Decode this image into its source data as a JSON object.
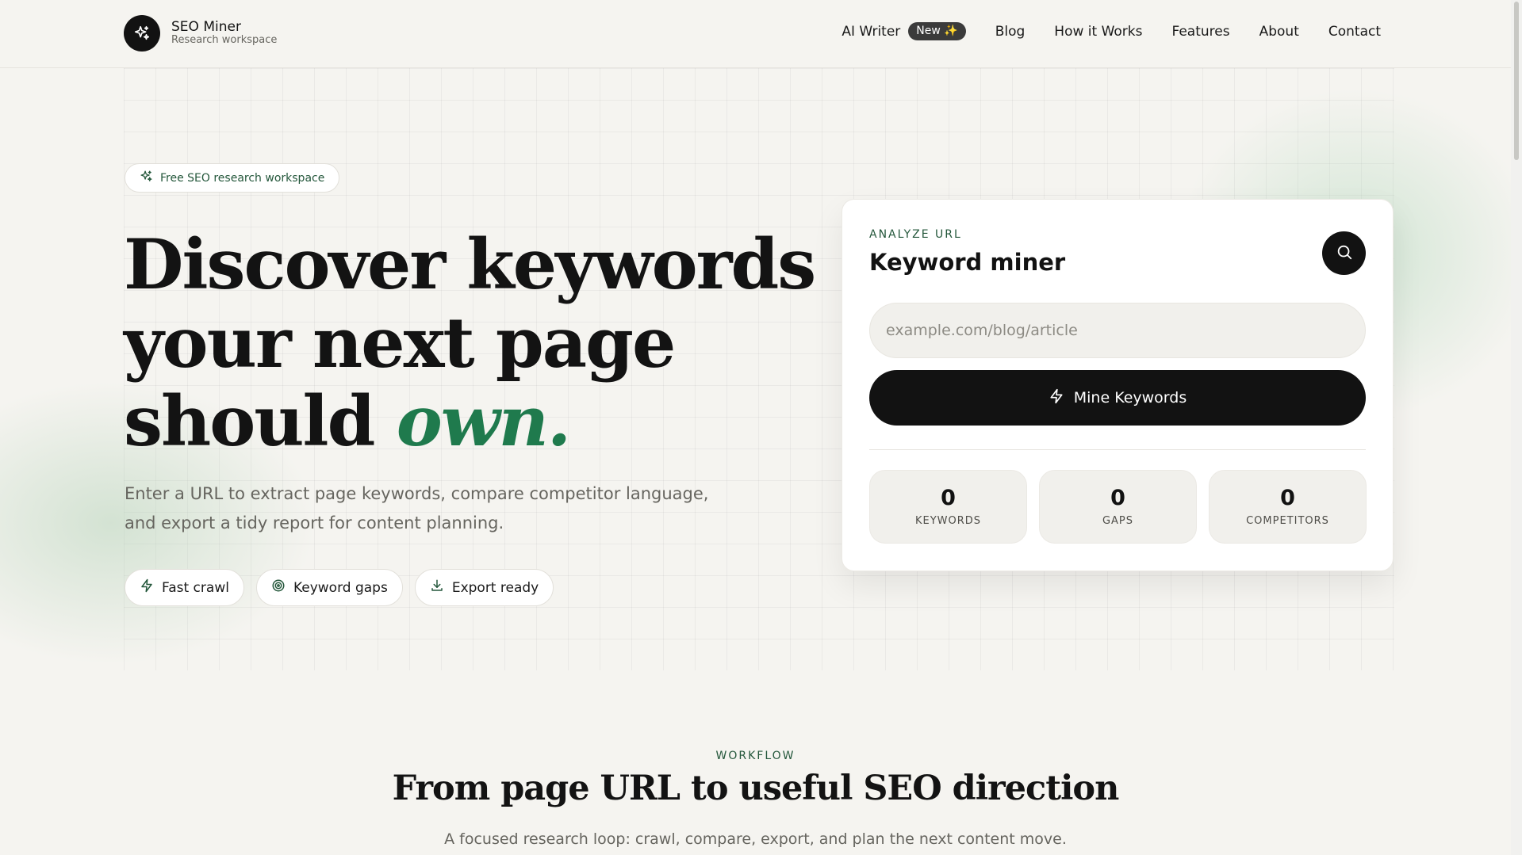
{
  "brand": {
    "name": "SEO Miner",
    "tagline": "Research workspace",
    "icon": "sparkle-icon"
  },
  "nav": {
    "ai_writer": "AI Writer",
    "new_badge": "New ✨",
    "blog": "Blog",
    "how_it_works": "How it Works",
    "features": "Features",
    "about": "About",
    "contact": "Contact"
  },
  "hero": {
    "pill": "Free SEO research workspace",
    "headline_line1": "Discover keywords",
    "headline_line2": "your next page",
    "headline_line3": "should ",
    "headline_accent": "own.",
    "lede": "Enter a URL to extract page keywords, compare competitor language, and export a tidy report for content planning.",
    "chips": [
      {
        "label": "Fast crawl",
        "icon": "lightning-icon"
      },
      {
        "label": "Keyword gaps",
        "icon": "target-icon"
      },
      {
        "label": "Export ready",
        "icon": "download-icon"
      }
    ]
  },
  "card": {
    "eyebrow": "ANALYZE URL",
    "title": "Keyword miner",
    "input_placeholder": "example.com/blog/article",
    "input_value": "",
    "button_label": "Mine Keywords",
    "stats": [
      {
        "value": "0",
        "label": "KEYWORDS"
      },
      {
        "value": "0",
        "label": "GAPS"
      },
      {
        "value": "0",
        "label": "COMPETITORS"
      }
    ]
  },
  "workflow": {
    "eyebrow": "WORKFLOW",
    "title": "From page URL to useful SEO direction",
    "subtitle": "A focused research loop: crawl, compare, export, and plan the next content move."
  },
  "colors": {
    "accent": "#1f7a4d",
    "dark": "#121212",
    "background": "#f5f4f0"
  }
}
